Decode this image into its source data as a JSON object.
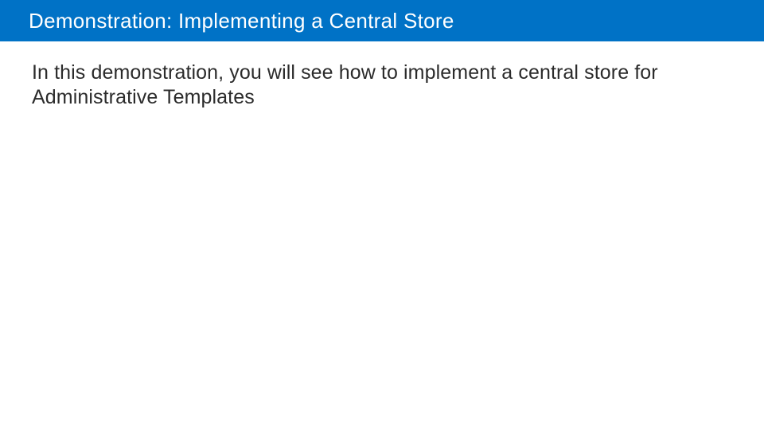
{
  "header": {
    "title": "Demonstration: Implementing a Central Store"
  },
  "content": {
    "body": "In this demonstration, you will see how to implement a central store for Administrative Templates"
  }
}
